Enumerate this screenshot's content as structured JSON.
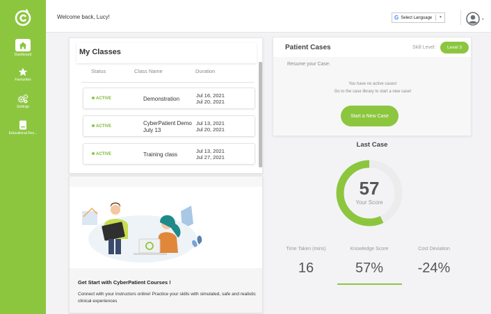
{
  "header": {
    "welcome": "Welcome back, Lucy!",
    "language_select": "Select Language",
    "language_caret": "▼"
  },
  "sidebar": {
    "items": [
      {
        "label": "Dashboard",
        "icon": "home-icon",
        "active": true
      },
      {
        "label": "Favourites",
        "icon": "star-icon"
      },
      {
        "label": "Settings",
        "icon": "gears-icon"
      },
      {
        "label": "Educational Res...",
        "icon": "book-icon"
      }
    ]
  },
  "classes": {
    "title": "My Classes",
    "columns": [
      "Status",
      "Class Name",
      "Duration"
    ],
    "rows": [
      {
        "status": "ACTIVE",
        "name": [
          "Demonstration"
        ],
        "start": "Jul 16, 2021",
        "end": "Jul 20, 2021"
      },
      {
        "status": "ACTIVE",
        "name": [
          "CyberPatient Demo",
          "July 13"
        ],
        "start": "Jul 13, 2021",
        "end": "Jul 20, 2021"
      },
      {
        "status": "ACTIVE",
        "name": [
          "Training class"
        ],
        "start": "Jul 13, 2021",
        "end": "Jul 27, 2021"
      }
    ]
  },
  "courses": {
    "title": "Get Start with CyberPatient Courses !",
    "description": "Connect with your instructors online! Practice your skills with simulated, safe and realistic clinical experiences"
  },
  "patient_cases": {
    "title": "Patient Cases",
    "skill_label": "Skill Level:",
    "level": "Level 3",
    "resume": "Resume your Case:",
    "empty_line1": "You have no active cases!",
    "empty_line2": "Go to the case library to start a new case!",
    "start_button": "Start a New Case"
  },
  "last_case": {
    "title": "Last Case",
    "score": "57",
    "score_fraction": 0.57,
    "score_label": "Your Score",
    "stats": [
      {
        "label": "Time Taken (mins)",
        "value": "16"
      },
      {
        "label": "Knowledge Score",
        "value": "57%"
      },
      {
        "label": "Cost Deviation",
        "value": "-24%"
      }
    ]
  },
  "colors": {
    "brand_green": "#8cc63f",
    "active_green": "#7fb53a"
  }
}
